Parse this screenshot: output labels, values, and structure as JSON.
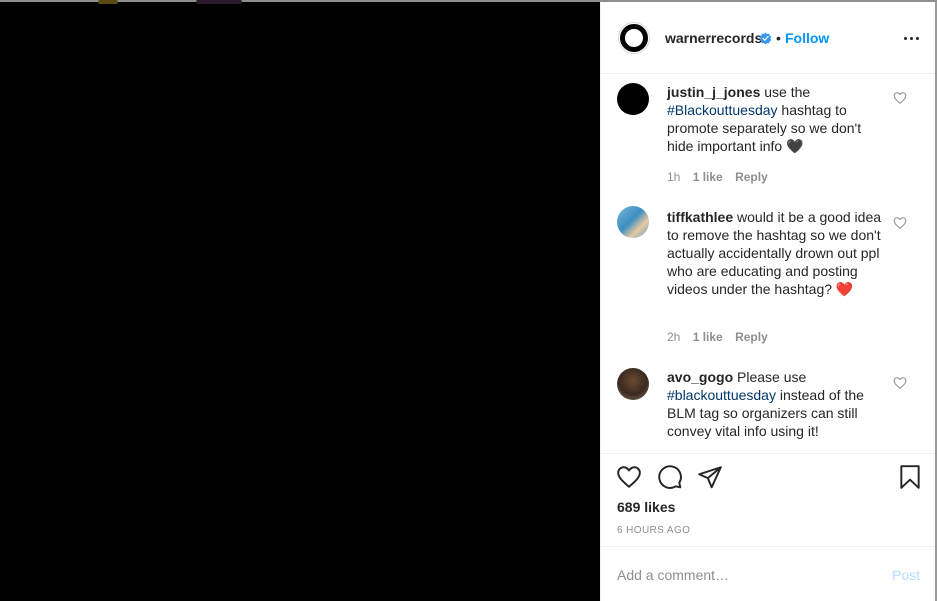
{
  "post": {
    "username": "warnerrecords",
    "verified": true,
    "separator": "•",
    "follow_label": "Follow",
    "more_icon": "more-options-icon"
  },
  "comments": [
    {
      "user": "justin_j_jones",
      "text_before": " use the ",
      "hashtag": "#Blackouttuesday",
      "text_after": " hashtag to promote separately so we don't hide important info ",
      "emoji": "🖤",
      "time": "1h",
      "likes": "1 like",
      "reply": "Reply"
    },
    {
      "user": "tiffkathlee",
      "text_before": " would it be a good idea to remove the hashtag so we don't actually accidentally drown out ppl who are educating and posting videos under the hashtag? ",
      "hashtag": "",
      "text_after": "",
      "emoji": "❤️",
      "time": "2h",
      "likes": "1 like",
      "reply": "Reply"
    },
    {
      "user": "avo_gogo",
      "text_before": " Please use ",
      "hashtag": "#blackouttuesday",
      "text_after": " instead of the BLM tag so organizers can still convey vital info using it!",
      "emoji": "",
      "time": "",
      "likes": "",
      "reply": ""
    }
  ],
  "actions": {
    "like_icon": "heart-icon",
    "comment_icon": "comment-icon",
    "share_icon": "share-icon",
    "save_icon": "bookmark-icon",
    "likes_count": "689 likes",
    "timestamp": "6 HOURS AGO"
  },
  "comment_box": {
    "placeholder": "Add a comment…",
    "post_label": "Post"
  },
  "colors": {
    "link_blue": "#0095f6",
    "hashtag_blue": "#00376b",
    "post_disabled": "#b3dbff",
    "muted": "#8e8e8e"
  }
}
